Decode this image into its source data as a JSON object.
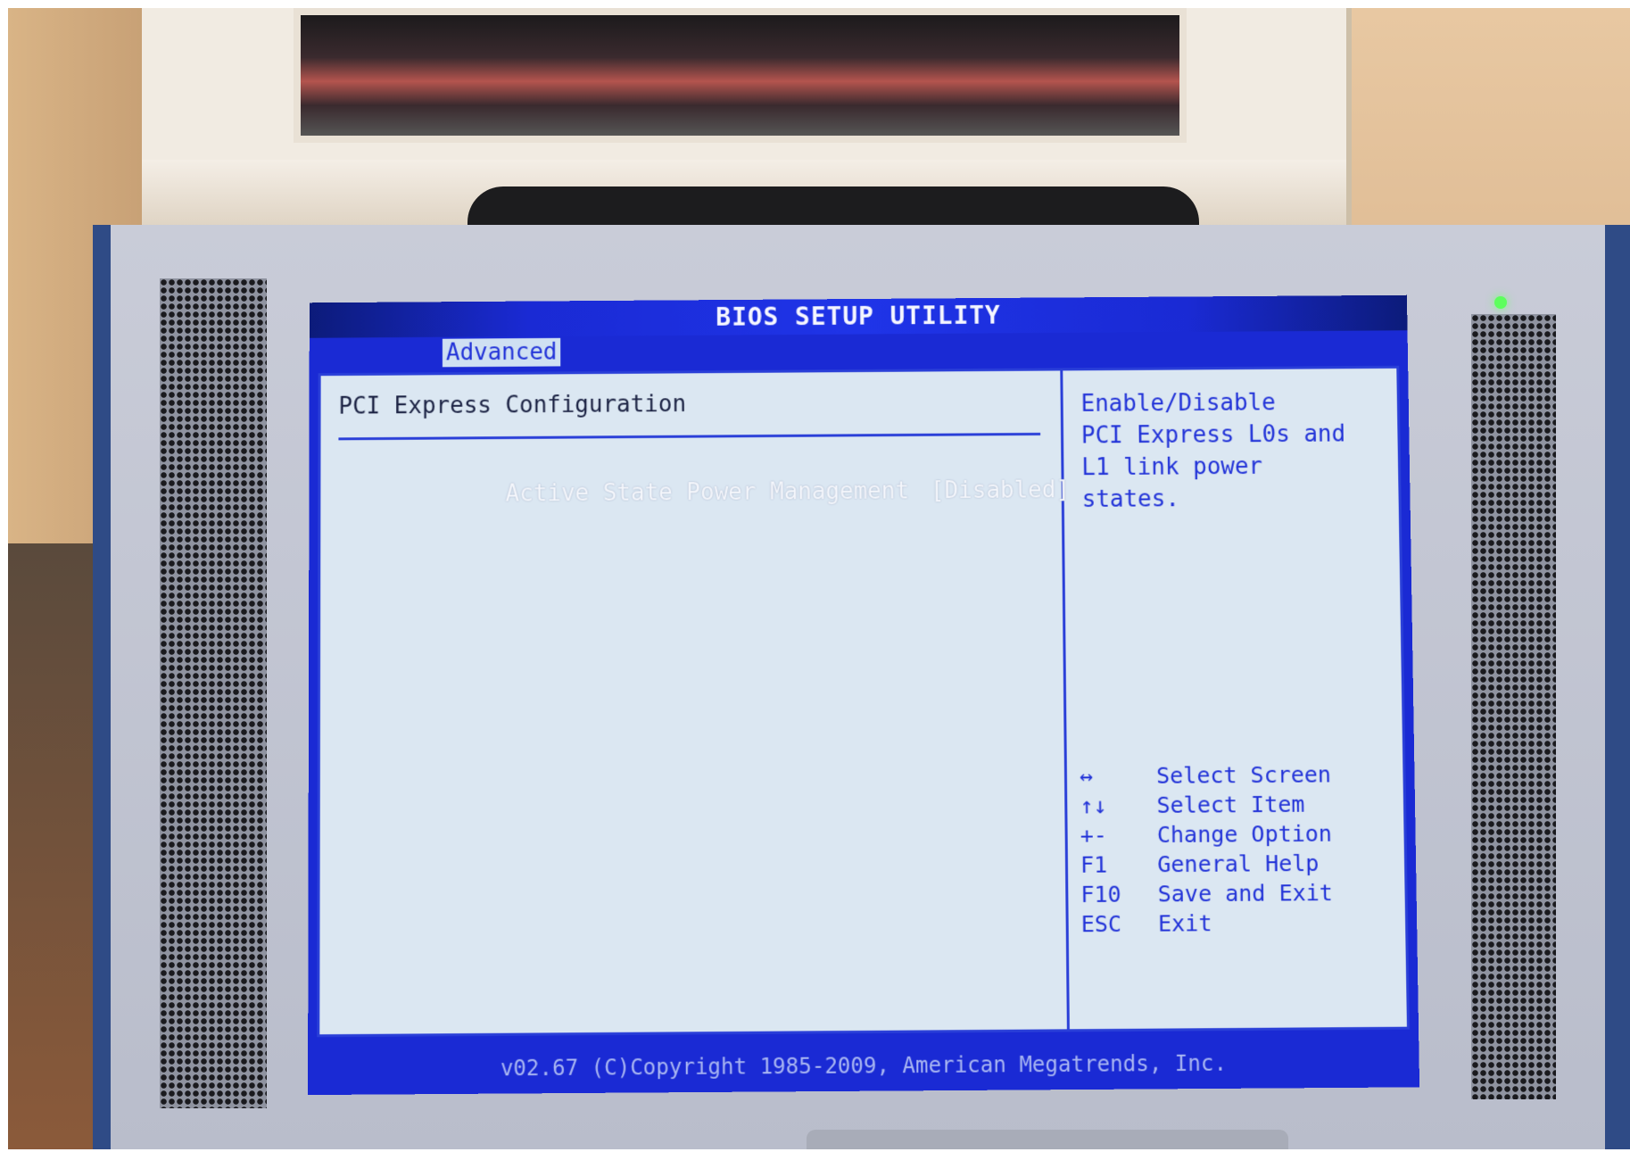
{
  "bios": {
    "title": "BIOS SETUP UTILITY",
    "active_tab": "Advanced",
    "page_title": "PCI Express Configuration",
    "setting": {
      "label": "Active State Power Management",
      "value": "[Disabled]"
    },
    "help_text": "Enable/Disable\nPCI Express L0s and\nL1 link power\nstates.",
    "keys": [
      {
        "key": "↔",
        "action": "Select Screen"
      },
      {
        "key": "↑↓",
        "action": "Select Item"
      },
      {
        "key": "+-",
        "action": "Change Option"
      },
      {
        "key": "F1",
        "action": "General Help"
      },
      {
        "key": "F10",
        "action": "Save and Exit"
      },
      {
        "key": "ESC",
        "action": "Exit"
      }
    ],
    "footer": "v02.67  (C)Copyright 1985-2009, American Megatrends, Inc."
  },
  "colors": {
    "bios_blue": "#1a2ad4",
    "panel_bg": "#dbe7f2",
    "text_blue": "#2233d8",
    "power_led": "#5dff5d"
  }
}
